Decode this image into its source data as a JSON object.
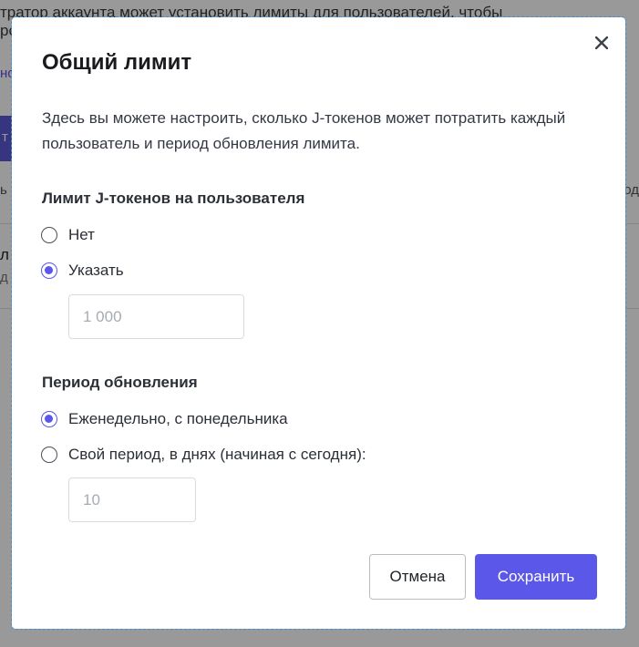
{
  "background": {
    "intro_text": "тратор аккаунта может установить лимиты для пользователей, чтобы",
    "intro_text_2": "ро",
    "link_text": "нс",
    "button_text": "т",
    "col_left": "ь",
    "col_right": "од",
    "row_primary": "л",
    "row_secondary": "д"
  },
  "dialog": {
    "title": "Общий лимит",
    "close_glyph": "✕",
    "description": "Здесь вы можете настроить, сколько J-токенов может потратить каждый пользователь и период обновления лимита.",
    "token_limit": {
      "title": "Лимит J-токенов на пользователя",
      "options": [
        {
          "label": "Нет",
          "checked": false
        },
        {
          "label": "Указать",
          "checked": true
        }
      ],
      "input_placeholder": "1 000",
      "input_value": ""
    },
    "refresh_period": {
      "title": "Период обновления",
      "options": [
        {
          "label": "Еженедельно, с понедельника",
          "checked": true
        },
        {
          "label": "Свой период, в днях (начиная с сегодня):",
          "checked": false
        }
      ],
      "input_placeholder": "10",
      "input_value": ""
    },
    "cancel_label": "Отмена",
    "save_label": "Сохранить"
  },
  "colors": {
    "accent": "#5b57e8",
    "overlay": "rgba(0,0,0,0.40)"
  }
}
